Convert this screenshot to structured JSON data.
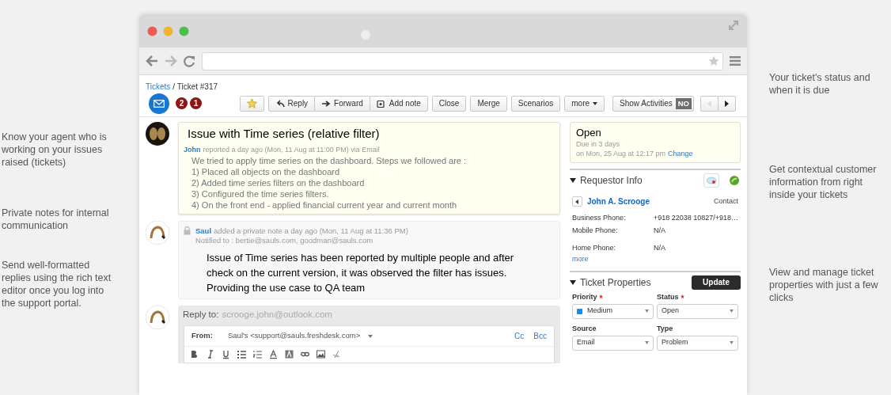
{
  "callouts_left": [
    {
      "text": "Know your agent who is working on your issues raised (tickets)"
    },
    {
      "text": "Private notes for internal communication"
    },
    {
      "text": "Send well-formatted replies using the rich text editor once you log into the support portal."
    }
  ],
  "callouts_right": [
    {
      "text": "Your ticket's status and when it is due"
    },
    {
      "text": "Get contextual customer information from right inside your tickets"
    },
    {
      "text": "View and manage ticket properties with just a few clicks"
    }
  ],
  "breadcrumb": {
    "link": "Tickets",
    "current": "/ Ticket #317"
  },
  "badges": [
    "2",
    "1"
  ],
  "action_group": [
    {
      "kind": "reply",
      "label": "Reply"
    },
    {
      "kind": "forward",
      "label": "Forward"
    },
    {
      "kind": "note",
      "label": "Add note"
    }
  ],
  "buttons": [
    {
      "label": "Close",
      "caret": false
    },
    {
      "label": "Merge",
      "caret": false
    },
    {
      "label": "Scenarios",
      "caret": false
    },
    {
      "label": "more",
      "caret": true
    }
  ],
  "show_activities": {
    "label": "Show Activities",
    "on": false,
    "state_text": "NO"
  },
  "conversation": [
    {
      "kind": "message",
      "title": "Issue with Time series (relative filter)",
      "author": "John",
      "meta": "reported a day ago (Mon, 11 Aug at 11:00 PM) via Email",
      "lines": [
        "We tried to apply time series on the dashboard. Steps we followed are :",
        "1) Placed all objects on the dashboard",
        "2) Added time series filters on the dashboard",
        "3) Configured the time series filters.",
        "4) On the front end - applied financial current year and current month"
      ]
    },
    {
      "kind": "note",
      "private": true,
      "author": "Saul",
      "meta": "added a private note a day ago (Mon, 11 Aug at 11:36 PM)",
      "notified": "Notified to : bertie@sauls.com, goodman@sauls.com",
      "body": "Issue of Time series has been reported by multiple people and after check on the current version, it was observed the filter has issues. Providing the use case to QA team"
    },
    {
      "kind": "reply",
      "reply_label": "Reply to:",
      "reply_to": "scrooge.john@outlook.com",
      "from_label": "From:",
      "from": "Saul's <support@sauls.freshdesk.com>",
      "cc": "Cc",
      "bcc": "Bcc"
    }
  ],
  "status": {
    "title": "Open",
    "due": "Due in 3 days",
    "due_date": "on Mon, 25 Aug at 12:17 pm",
    "change": "Change"
  },
  "requestor": {
    "heading": "Requestor Info",
    "expanded": true,
    "name": "John A. Scrooge",
    "contact": "Contact",
    "fields": [
      {
        "label": "Business Phone:",
        "value": "+918 22038 10827/+918…"
      },
      {
        "label": "Mobile Phone:",
        "value": "N/A"
      },
      {
        "label": "Home Phone:",
        "value": "N/A"
      }
    ],
    "more": "more"
  },
  "properties": {
    "heading": "Ticket Properties",
    "expanded": true,
    "update": "Update",
    "fields": [
      {
        "label": "Priority",
        "required": true,
        "value": "Medium",
        "color": "#1e88e5"
      },
      {
        "label": "Status",
        "required": true,
        "value": "Open"
      },
      {
        "label": "Source",
        "required": false,
        "value": "Email"
      },
      {
        "label": "Type",
        "required": false,
        "value": "Problem"
      }
    ]
  }
}
